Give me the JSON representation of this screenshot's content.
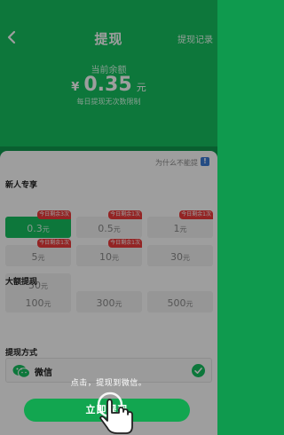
{
  "header": {
    "title": "提现",
    "records_link": "提现记录",
    "balance_label": "当前余额",
    "currency_symbol": "¥",
    "balance": "0.35",
    "balance_unit": "元",
    "limit_text": "每日提现无次数限制",
    "back_icon": "chevron-left-icon"
  },
  "card": {
    "why_link": "为什么不能提",
    "info_badge": "!",
    "new_user_title": "新人专享",
    "large_title": "大额提现",
    "method_title": "提现方式",
    "yuan": "元",
    "new_user_options": [
      {
        "amount": "0.3",
        "tag": "今日剩余3次",
        "selected": true
      },
      {
        "amount": "0.5",
        "tag": "今日剩余1次",
        "selected": false
      },
      {
        "amount": "1",
        "tag": "今日剩余1次",
        "selected": false
      },
      {
        "amount": "5",
        "tag": "今日剩余1次",
        "selected": false
      },
      {
        "amount": "10",
        "tag": "今日剩余1次",
        "selected": false
      },
      {
        "amount": "30",
        "tag": "",
        "selected": false
      },
      {
        "amount": "50",
        "tag": "",
        "selected": false
      }
    ],
    "large_options": [
      {
        "amount": "100"
      },
      {
        "amount": "300"
      },
      {
        "amount": "500"
      }
    ],
    "method": {
      "label": "微信",
      "icon": "wechat-icon",
      "checked": true
    }
  },
  "tutorial": {
    "hint": "点击，提现到微信。",
    "hand_icon": "pointing-hand-icon"
  },
  "withdraw_button": "立即提现",
  "colors": {
    "brand_green": "#16c160",
    "tag_red": "#ee3b3b",
    "info_blue": "#3a7bd5"
  }
}
